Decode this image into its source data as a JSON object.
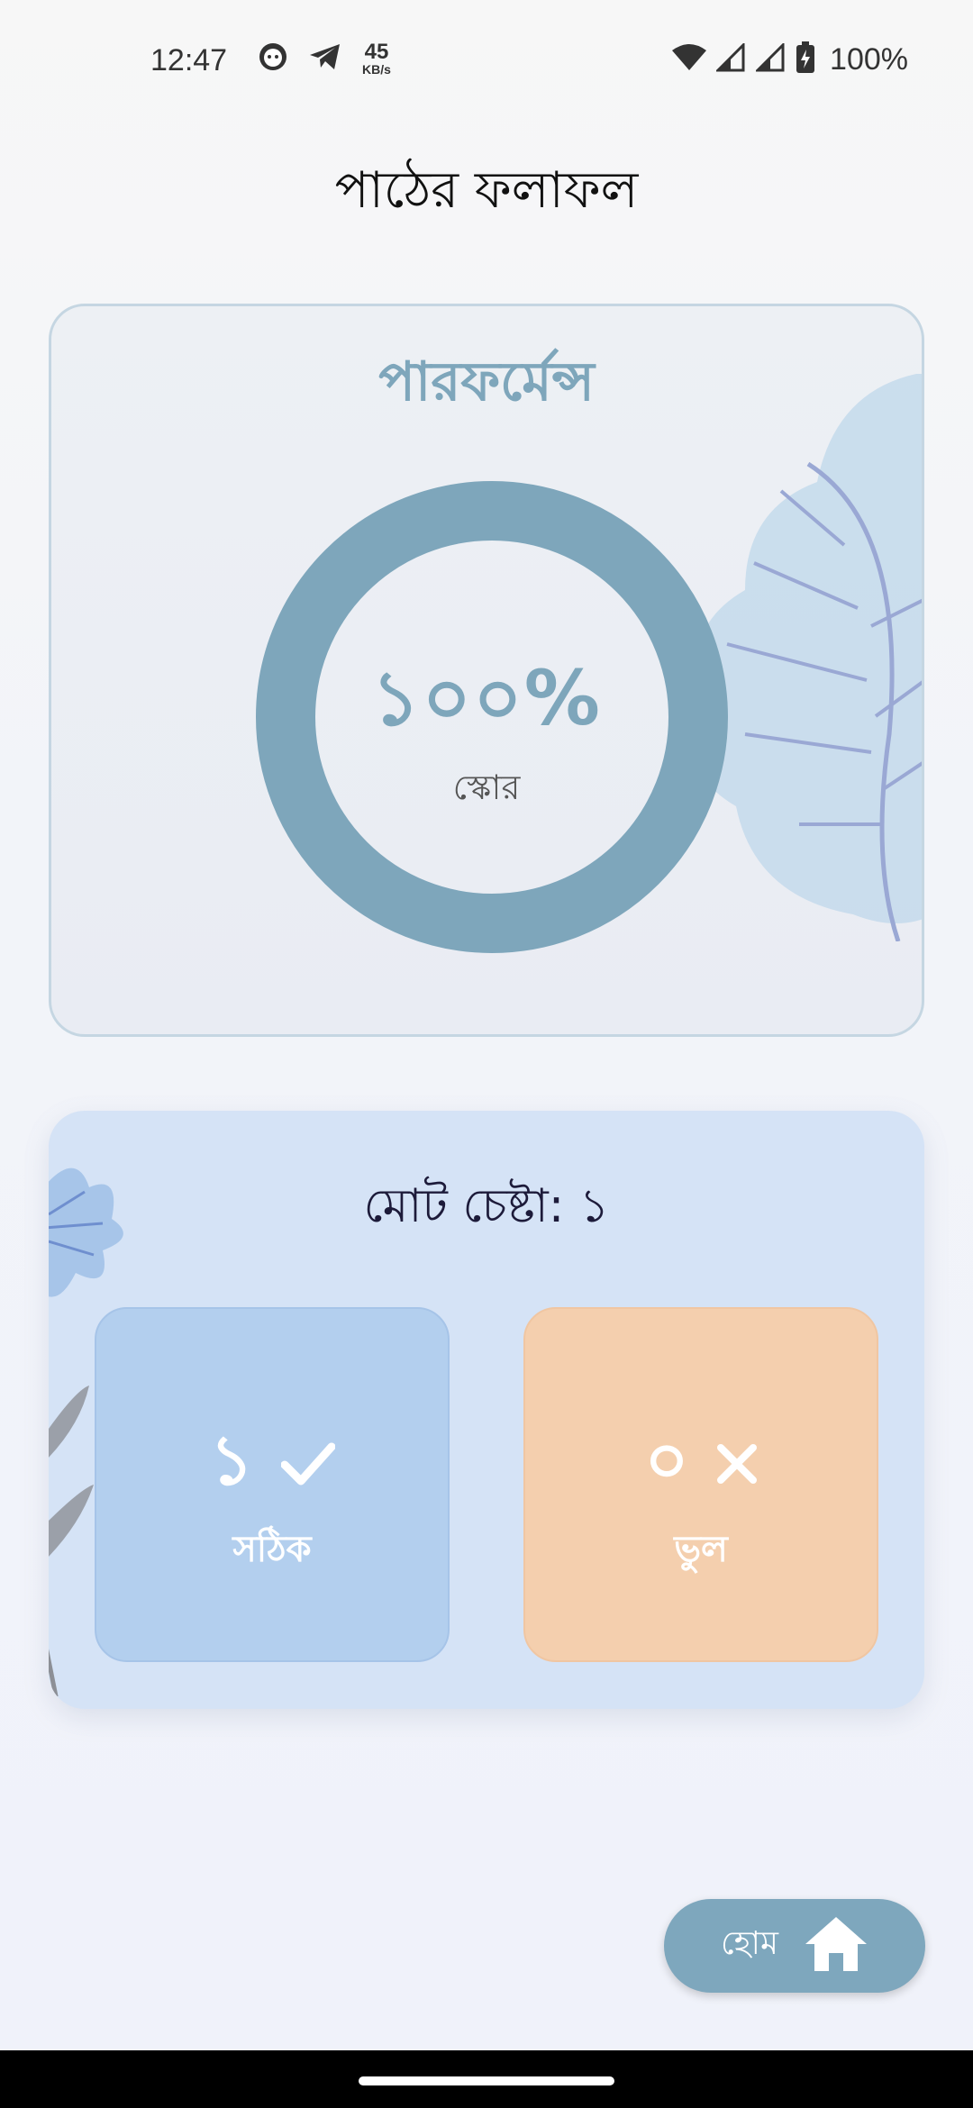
{
  "status_bar": {
    "time": "12:47",
    "net_speed_value": "45",
    "net_speed_unit": "KB/s",
    "battery": "100%",
    "icons": [
      "face-notification-icon",
      "telegram-icon",
      "wifi-icon",
      "signal-icon",
      "signal-icon",
      "battery-charging-icon"
    ]
  },
  "page_title": "পাঠের ফলাফল",
  "performance": {
    "title": "পারফর্মেন্স",
    "score_value": "১০০%",
    "score_label": "স্কোর",
    "score_fraction": 1.0,
    "ring_color": "#7ea6bb"
  },
  "attempts": {
    "title": "মোট চেষ্টা: ১",
    "correct": {
      "value": "১",
      "label": "সঠিক",
      "icon": "check-icon",
      "color": "#b3cfee"
    },
    "wrong": {
      "value": "০",
      "label": "ভুল",
      "icon": "close-icon",
      "color": "#f4cfae"
    }
  },
  "home_button": {
    "label": "হোম",
    "icon": "home-icon",
    "color": "#7ea7bd"
  }
}
